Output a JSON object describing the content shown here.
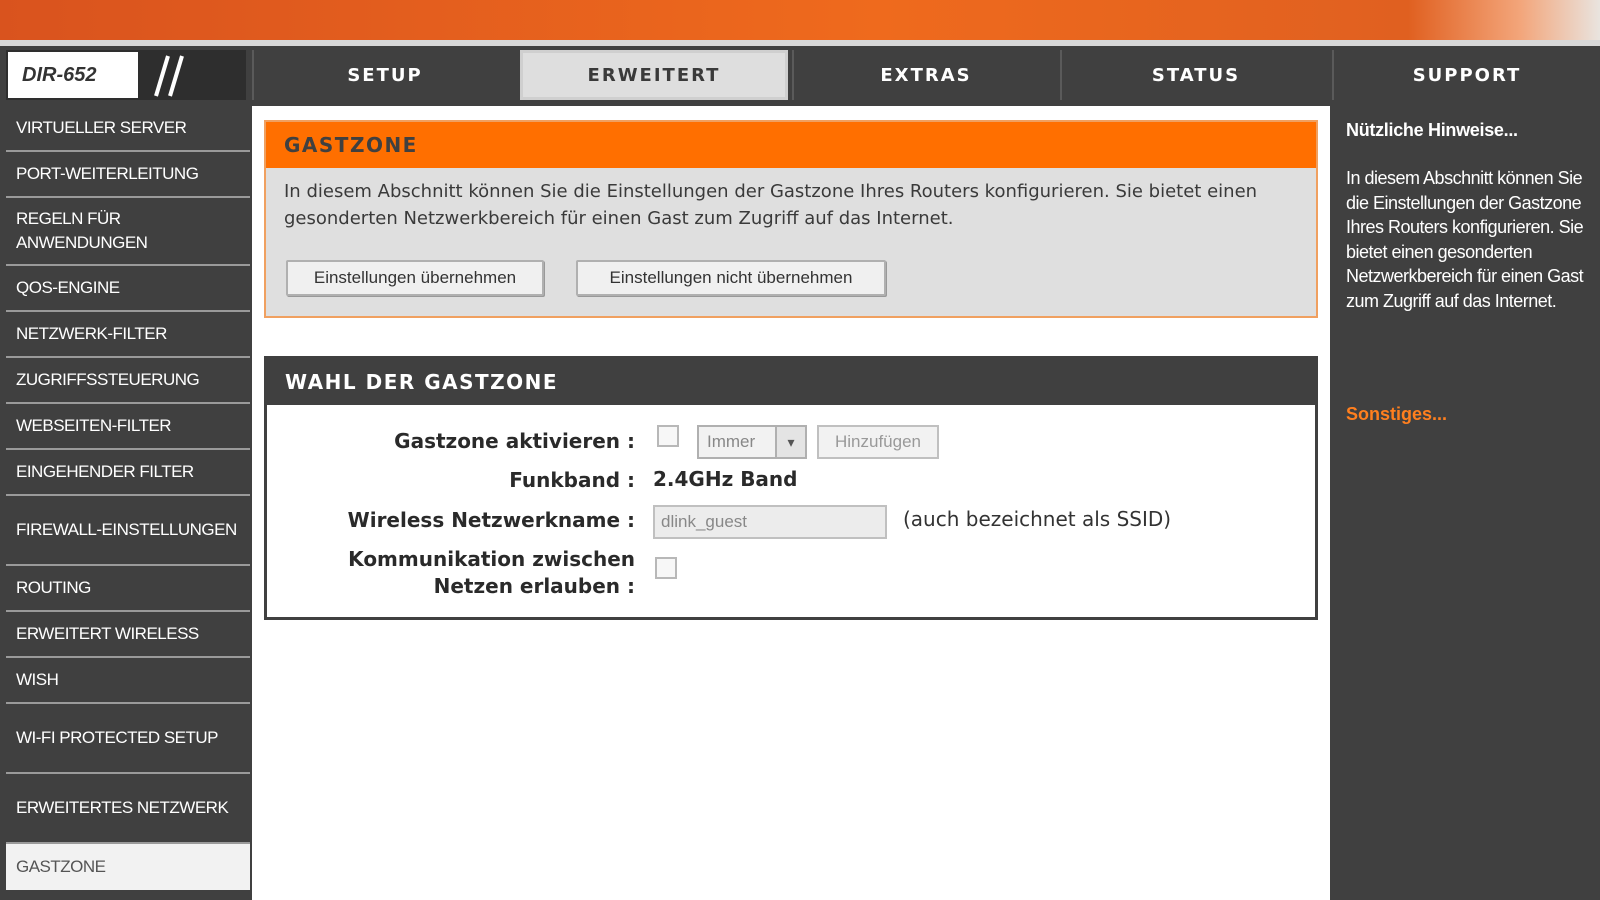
{
  "device": {
    "model": "DIR-652"
  },
  "nav": {
    "tabs": [
      {
        "label": "SETUP"
      },
      {
        "label": "ERWEITERT"
      },
      {
        "label": "EXTRAS"
      },
      {
        "label": "STATUS"
      },
      {
        "label": "SUPPORT"
      }
    ],
    "active_tab": "ERWEITERT"
  },
  "sidebar": {
    "items": [
      {
        "label": "VIRTUELLER SERVER"
      },
      {
        "label": "PORT-WEITERLEITUNG"
      },
      {
        "label": "REGELN FÜR ANWENDUNGEN"
      },
      {
        "label": "QOS-ENGINE"
      },
      {
        "label": "NETZWERK-FILTER"
      },
      {
        "label": "ZUGRIFFSSTEUERUNG"
      },
      {
        "label": "WEBSEITEN-FILTER"
      },
      {
        "label": "EINGEHENDER FILTER"
      },
      {
        "label": "FIREWALL-EINSTELLUNGEN"
      },
      {
        "label": "ROUTING"
      },
      {
        "label": "ERWEITERT WIRELESS"
      },
      {
        "label": "WISH"
      },
      {
        "label": "WI-FI PROTECTED SETUP"
      },
      {
        "label": "ERWEITERTES NETZWERK"
      },
      {
        "label": "GASTZONE"
      }
    ],
    "active_item": "GASTZONE"
  },
  "intro": {
    "title": "GASTZONE",
    "description": "In diesem Abschnitt können Sie die Einstellungen der Gastzone Ihres Routers konfigurieren. Sie bietet einen gesonderten Netzwerkbereich für einen Gast zum Zugriff auf das Internet.",
    "save_label": "Einstellungen übernehmen",
    "cancel_label": "Einstellungen nicht übernehmen"
  },
  "guest_zone": {
    "title": "WAHL DER GASTZONE",
    "enable_label": "Gastzone aktivieren :",
    "enable_checked": false,
    "schedule_selected": "Immer",
    "add_label": "Hinzufügen",
    "band_label": "Funkband :",
    "band_value": "2.4GHz Band",
    "ssid_label": "Wireless Netzwerkname :",
    "ssid_value": "dlink_guest",
    "ssid_hint": "(auch bezeichnet als SSID)",
    "comm_label_line1": "Kommunikation zwischen",
    "comm_label_line2": "Netzen erlauben :",
    "comm_checked": false
  },
  "help": {
    "title": "Nützliche Hinweise...",
    "text": "In diesem Abschnitt können Sie die Einstellungen der Gastzone Ihres Routers konfigurieren. Sie bietet einen gesonderten Netzwerkbereich für einen Gast zum Zugriff auf das Internet.",
    "more_label": "Sonstiges..."
  },
  "colors": {
    "accent_orange": "#ff6f00",
    "dark_bg": "#404040",
    "link_orange": "#ff7f1e"
  }
}
